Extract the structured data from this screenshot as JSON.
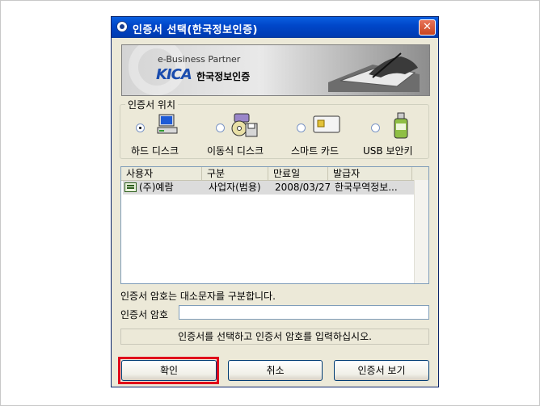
{
  "window": {
    "title": "인증서 선택(한국정보인증)",
    "close_glyph": "✕"
  },
  "banner": {
    "tagline": "e-Business Partner",
    "brand": "KICA",
    "brand_korean": "한국정보인증"
  },
  "location": {
    "legend": "인증서 위치",
    "options": [
      {
        "label": "하드 디스크",
        "icon": "hard-disk-icon",
        "selected": true
      },
      {
        "label": "이동식 디스크",
        "icon": "removable-disk-icon",
        "selected": false
      },
      {
        "label": "스마트 카드",
        "icon": "smart-card-icon",
        "selected": false
      },
      {
        "label": "USB 보안키",
        "icon": "usb-token-icon",
        "selected": false
      }
    ]
  },
  "list": {
    "columns": [
      "사용자",
      "구분",
      "만료일",
      "발급자"
    ],
    "rows": [
      {
        "user": "(주)예람",
        "type": "사업자(범용)",
        "expiry": "2008/03/27",
        "issuer": "한국무역정보..."
      }
    ]
  },
  "password": {
    "hint": "인증서 암호는 대소문자를 구분합니다.",
    "label": "인증서 암호",
    "value": ""
  },
  "status": "인증서를 선택하고 인증서 암호를 입력하십시오.",
  "buttons": {
    "ok": "확인",
    "cancel": "취소",
    "view": "인증서 보기"
  },
  "colors": {
    "titlebar": "#0047c9",
    "dialog_bg": "#ece9d8",
    "highlight": "#e0001b"
  }
}
